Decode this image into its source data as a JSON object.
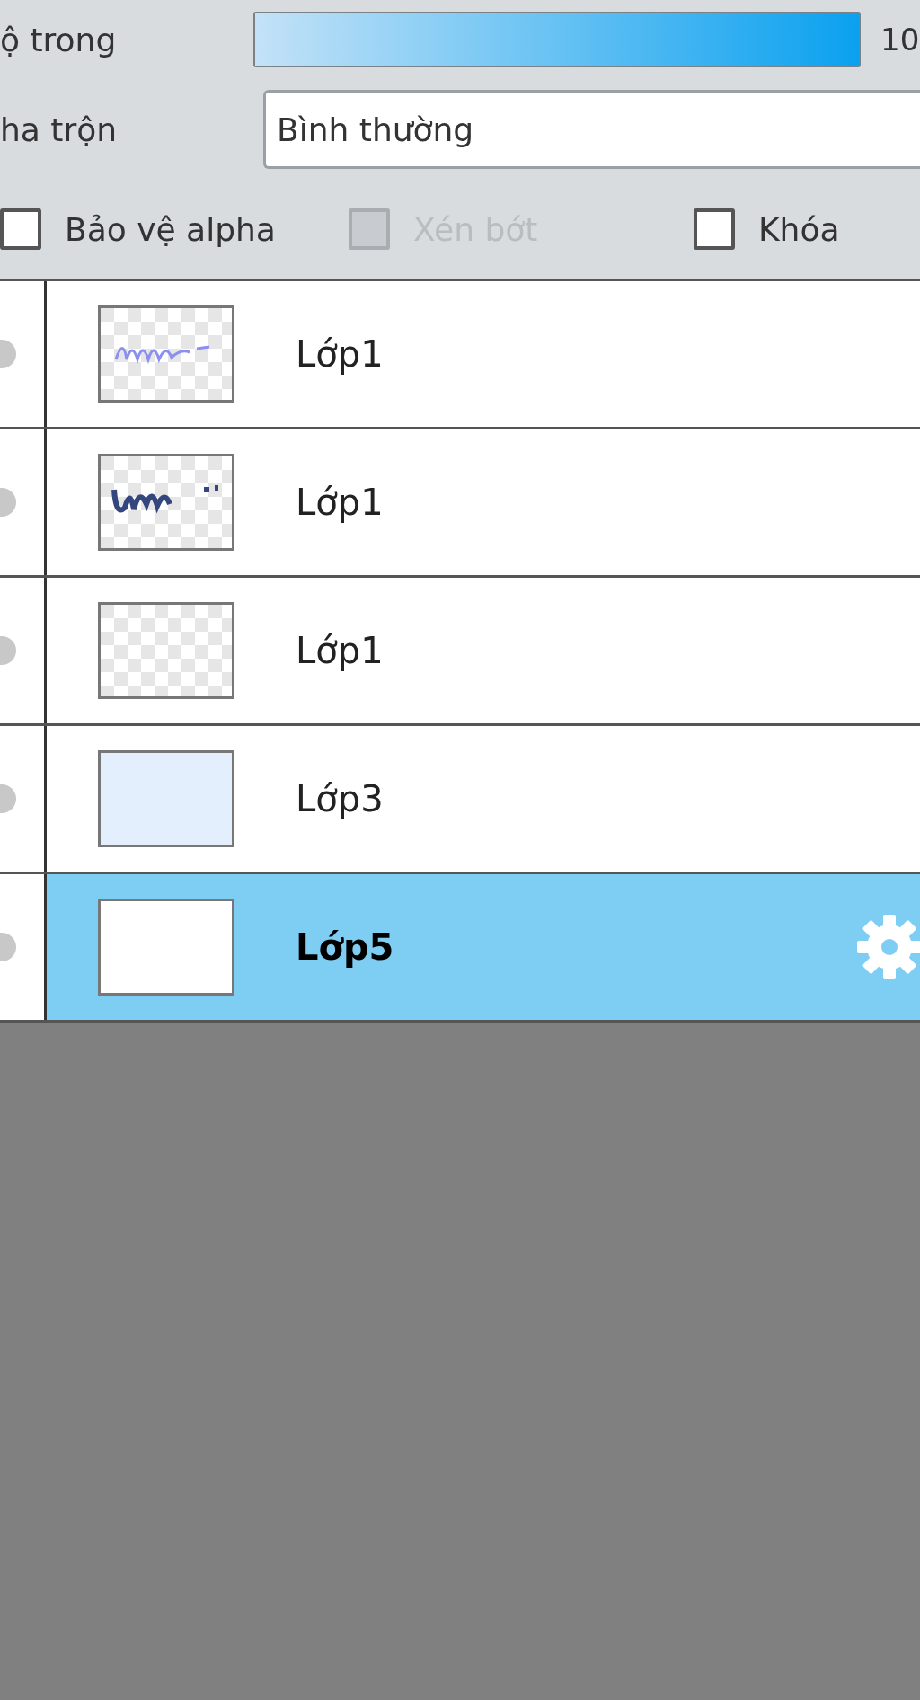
{
  "opacity": {
    "label": "ộ trong",
    "level": 1.0,
    "reading": "10"
  },
  "blend": {
    "label": "ha trộn",
    "value": "Bình thường"
  },
  "options": [
    {
      "label": "Bảo vệ alpha",
      "checked": false,
      "disabled": false
    },
    {
      "label": "Xén bớt",
      "checked": false,
      "disabled": true
    },
    {
      "label": "Khóa",
      "checked": false,
      "disabled": false
    }
  ],
  "layers": [
    {
      "name": "Lớp1",
      "selected": false,
      "kind": "faint"
    },
    {
      "name": "Lớp1",
      "selected": false,
      "kind": "dark"
    },
    {
      "name": "Lớp1",
      "selected": false,
      "kind": "blank"
    },
    {
      "name": "Lớp3",
      "selected": false,
      "kind": "tinted"
    },
    {
      "name": "Lớp5",
      "selected": true,
      "kind": "white"
    }
  ]
}
